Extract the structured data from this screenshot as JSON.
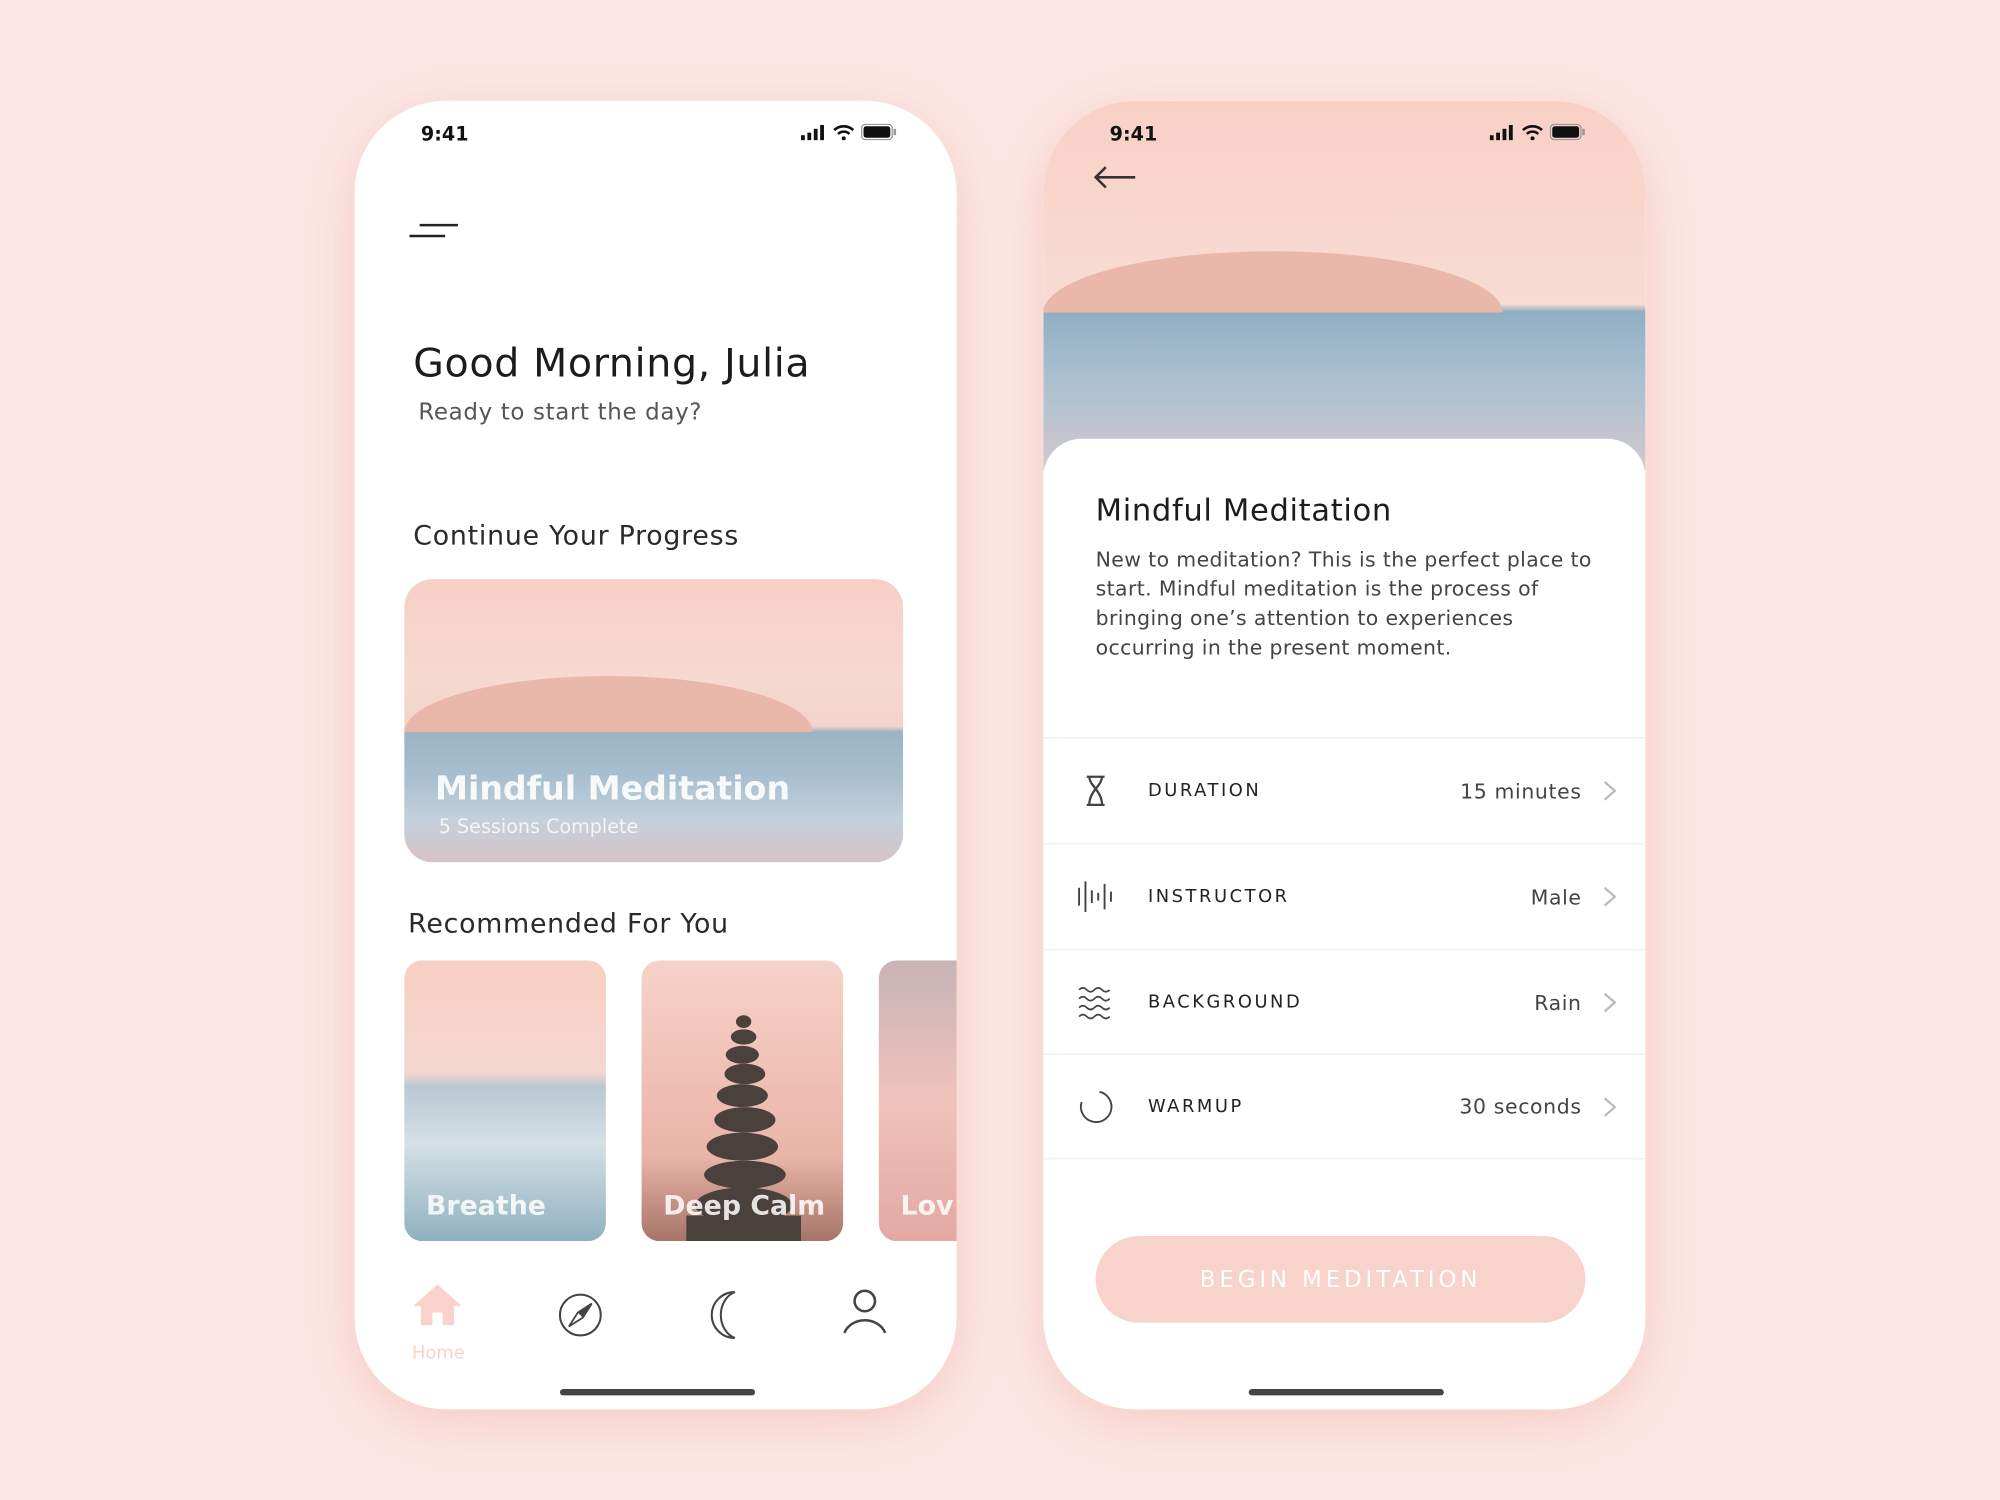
{
  "status": {
    "time": "9:41"
  },
  "home": {
    "greeting": "Good Morning, Julia",
    "subtitle": "Ready to start the day?",
    "progress_heading": "Continue Your Progress",
    "progress_card": {
      "title": "Mindful Meditation",
      "subtitle": "5 Sessions Complete"
    },
    "recommended_heading": "Recommended For You",
    "recommended": [
      {
        "label": "Breathe"
      },
      {
        "label": "Deep Calm"
      },
      {
        "label": "Lov"
      }
    ],
    "nav": [
      {
        "label": "Home",
        "icon": "home-icon",
        "active": true
      },
      {
        "icon": "compass-icon"
      },
      {
        "icon": "moon-icon"
      },
      {
        "icon": "profile-icon"
      }
    ]
  },
  "detail": {
    "title": "Mindful Meditation",
    "description": "New to meditation? This is the perfect place to start. Mindful meditation is the process of bringing one’s attention to experiences occurring in the present moment.",
    "settings": [
      {
        "icon": "hourglass-icon",
        "label": "DURATION",
        "value": "15 minutes"
      },
      {
        "icon": "soundwave-icon",
        "label": "INSTRUCTOR",
        "value": "Male"
      },
      {
        "icon": "waves-icon",
        "label": "BACKGROUND",
        "value": "Rain"
      },
      {
        "icon": "spinner-icon",
        "label": "WARMUP",
        "value": "30 seconds"
      }
    ],
    "begin_button": "BEGIN MEDITATION"
  },
  "colors": {
    "background": "#fce7e4",
    "accent": "#f7d3cc",
    "text": "#1c1c1c"
  }
}
